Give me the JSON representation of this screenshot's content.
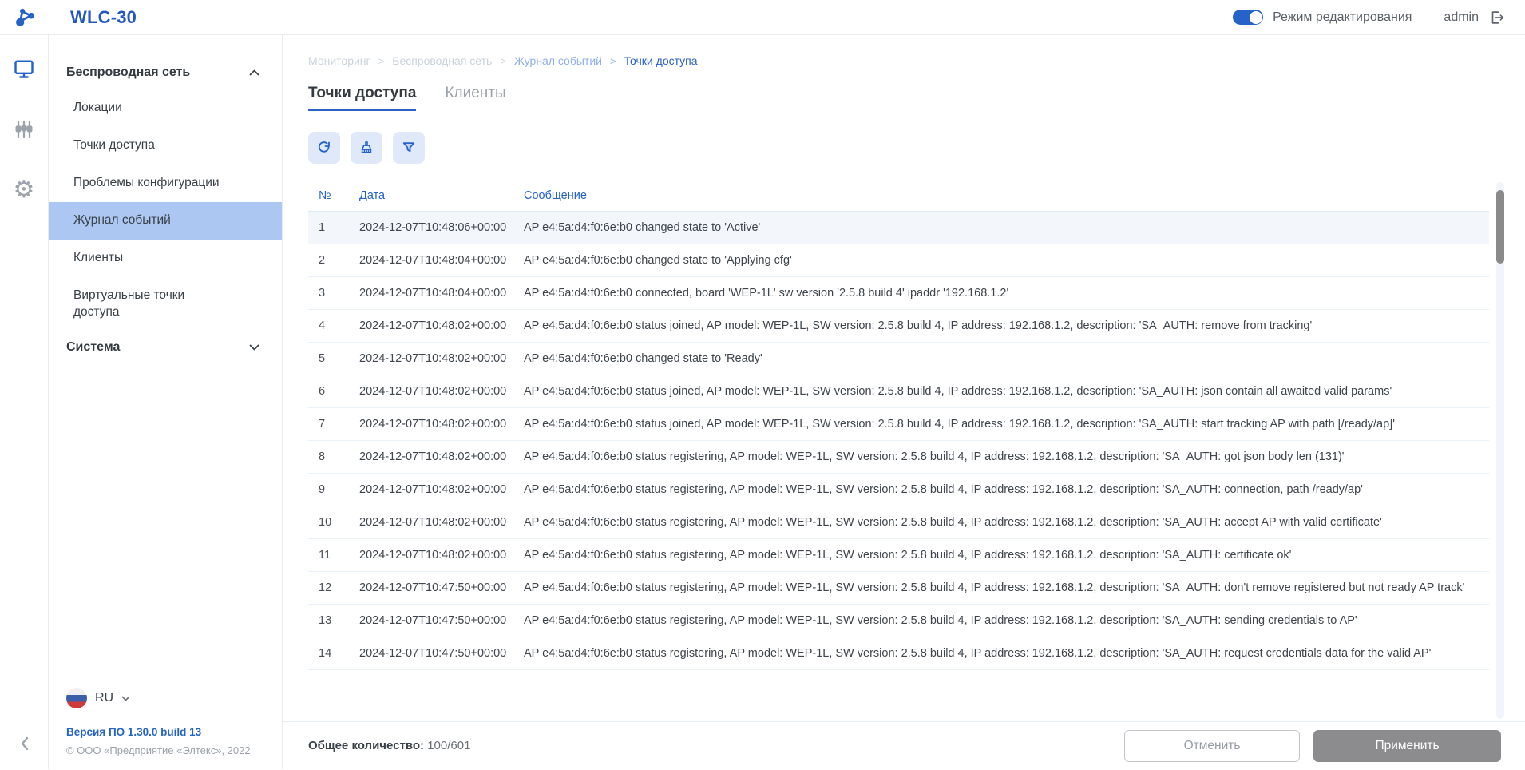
{
  "app": {
    "title": "WLC-30"
  },
  "topbar": {
    "edit_mode_label": "Режим редактирования",
    "edit_mode_on": true,
    "username": "admin"
  },
  "colors": {
    "accent_blue": "#2A62C5",
    "link_blue": "#2563C9",
    "selected_sidebar_bg": "#ABC7F2",
    "toolbar_button_bg": "#DFE9F9",
    "apply_button_bg": "#8C8C8F",
    "row_separator": "#EAF1F8"
  },
  "icon_rail": {
    "items": [
      {
        "name": "monitoring",
        "icon": "monitor-icon",
        "active": true
      },
      {
        "name": "configuration",
        "icon": "sliders-icon",
        "active": false
      },
      {
        "name": "settings",
        "icon": "gear-icon",
        "active": false
      }
    ]
  },
  "sidebar": {
    "wireless": {
      "label": "Беспроводная сеть",
      "expanded": true,
      "items": [
        {
          "label": "Локации",
          "selected": false
        },
        {
          "label": "Точки доступа",
          "selected": false
        },
        {
          "label": "Проблемы конфигурации",
          "selected": false
        },
        {
          "label": "Журнал событий",
          "selected": true
        },
        {
          "label": "Клиенты",
          "selected": false
        },
        {
          "label": "Виртуальные точки доступа",
          "selected": false
        }
      ]
    },
    "system": {
      "label": "Система",
      "expanded": false
    },
    "language": {
      "code": "RU"
    },
    "version_label": "Версия ПО 1.30.0 build 13",
    "copyright": "© ООО «Предприятие «Элтекс», 2022"
  },
  "breadcrumb": {
    "items": [
      "Мониторинг",
      "Беспроводная сеть",
      "Журнал событий",
      "Точки доступа"
    ],
    "separator": ">"
  },
  "tabs": [
    {
      "label": "Точки доступа",
      "active": true
    },
    {
      "label": "Клиенты",
      "active": false
    }
  ],
  "table": {
    "columns": [
      "№",
      "Дата",
      "Сообщение"
    ],
    "rows": [
      {
        "num": "1",
        "date": "2024-12-07T10:48:06+00:00",
        "message": "AP e4:5a:d4:f0:6e:b0 changed state to 'Active'"
      },
      {
        "num": "2",
        "date": "2024-12-07T10:48:04+00:00",
        "message": "AP e4:5a:d4:f0:6e:b0 changed state to 'Applying cfg'"
      },
      {
        "num": "3",
        "date": "2024-12-07T10:48:04+00:00",
        "message": "AP e4:5a:d4:f0:6e:b0 connected, board 'WEP-1L' sw version '2.5.8 build 4' ipaddr '192.168.1.2'"
      },
      {
        "num": "4",
        "date": "2024-12-07T10:48:02+00:00",
        "message": "AP e4:5a:d4:f0:6e:b0 status joined, AP model: WEP-1L, SW version: 2.5.8 build 4, IP address: 192.168.1.2, description: 'SA_AUTH: remove from tracking'"
      },
      {
        "num": "5",
        "date": "2024-12-07T10:48:02+00:00",
        "message": "AP e4:5a:d4:f0:6e:b0 changed state to 'Ready'"
      },
      {
        "num": "6",
        "date": "2024-12-07T10:48:02+00:00",
        "message": "AP e4:5a:d4:f0:6e:b0 status joined, AP model: WEP-1L, SW version: 2.5.8 build 4, IP address: 192.168.1.2, description: 'SA_AUTH: json contain all awaited valid params'"
      },
      {
        "num": "7",
        "date": "2024-12-07T10:48:02+00:00",
        "message": "AP e4:5a:d4:f0:6e:b0 status joined, AP model: WEP-1L, SW version: 2.5.8 build 4, IP address: 192.168.1.2, description: 'SA_AUTH: start tracking AP with path [/ready/ap]'"
      },
      {
        "num": "8",
        "date": "2024-12-07T10:48:02+00:00",
        "message": "AP e4:5a:d4:f0:6e:b0 status registering, AP model: WEP-1L, SW version: 2.5.8 build 4, IP address: 192.168.1.2, description: 'SA_AUTH: got json body len (131)'"
      },
      {
        "num": "9",
        "date": "2024-12-07T10:48:02+00:00",
        "message": "AP e4:5a:d4:f0:6e:b0 status registering, AP model: WEP-1L, SW version: 2.5.8 build 4, IP address: 192.168.1.2, description: 'SA_AUTH: connection, path /ready/ap'"
      },
      {
        "num": "10",
        "date": "2024-12-07T10:48:02+00:00",
        "message": "AP e4:5a:d4:f0:6e:b0 status registering, AP model: WEP-1L, SW version: 2.5.8 build 4, IP address: 192.168.1.2, description: 'SA_AUTH: accept AP with valid certificate'"
      },
      {
        "num": "11",
        "date": "2024-12-07T10:48:02+00:00",
        "message": "AP e4:5a:d4:f0:6e:b0 status registering, AP model: WEP-1L, SW version: 2.5.8 build 4, IP address: 192.168.1.2, description: 'SA_AUTH: certificate ok'"
      },
      {
        "num": "12",
        "date": "2024-12-07T10:47:50+00:00",
        "message": "AP e4:5a:d4:f0:6e:b0 status registering, AP model: WEP-1L, SW version: 2.5.8 build 4, IP address: 192.168.1.2, description: 'SA_AUTH: don't remove registered but not ready AP track'"
      },
      {
        "num": "13",
        "date": "2024-12-07T10:47:50+00:00",
        "message": "AP e4:5a:d4:f0:6e:b0 status registering, AP model: WEP-1L, SW version: 2.5.8 build 4, IP address: 192.168.1.2, description: 'SA_AUTH: sending credentials to AP'"
      },
      {
        "num": "14",
        "date": "2024-12-07T10:47:50+00:00",
        "message": "AP e4:5a:d4:f0:6e:b0 status registering, AP model: WEP-1L, SW version: 2.5.8 build 4, IP address: 192.168.1.2, description: 'SA_AUTH: request credentials data for the valid AP'"
      }
    ]
  },
  "footer": {
    "total_label": "Общее количество:",
    "total_value": "100/601",
    "cancel_label": "Отменить",
    "apply_label": "Применить"
  }
}
